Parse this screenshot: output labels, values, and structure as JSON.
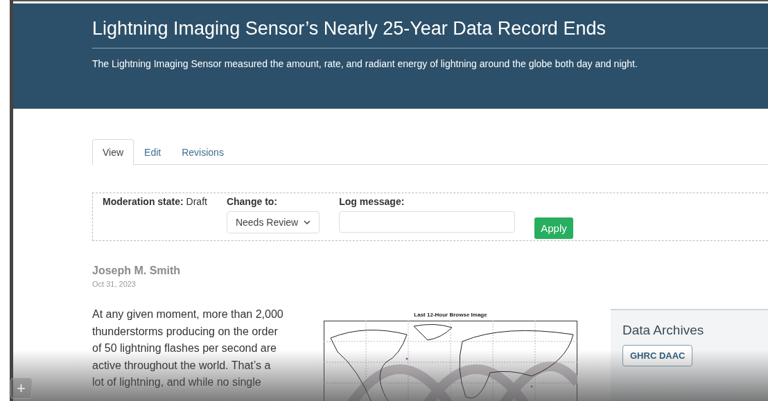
{
  "header": {
    "title": "Lightning Imaging Sensor’s Nearly 25-Year Data Record Ends",
    "subtitle": "The Lightning Imaging Sensor measured the amount, rate, and radiant energy of lightning around the globe both day and night."
  },
  "tabs": [
    {
      "label": "View",
      "selected": true
    },
    {
      "label": "Edit",
      "selected": false
    },
    {
      "label": "Revisions",
      "selected": false
    }
  ],
  "moderation": {
    "state_label": "Moderation state:",
    "state_value": "Draft",
    "change_label": "Change to:",
    "change_value": "Needs Review",
    "log_label": "Log message:",
    "apply": "Apply"
  },
  "article": {
    "author": "Joseph M. Smith",
    "date": "Oct 31, 2023",
    "body_lines": [
      "At any given moment, more than 2,000",
      "thunderstorms producing on the order",
      "of 50 lightning flashes per second are",
      "active throughout the world. That’s a",
      "lot of lightning, and while no single"
    ],
    "figure": {
      "title": "Last 12-Hour Browse Image",
      "kind": "picture"
    }
  },
  "sidebar": {
    "title": "Data Archives",
    "tags": [
      "GHRC DAAC"
    ]
  },
  "player": {
    "add_button": "+"
  }
}
